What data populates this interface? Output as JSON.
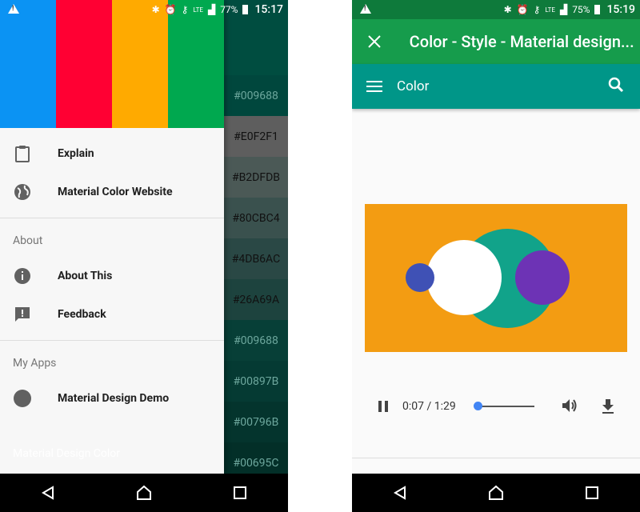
{
  "left": {
    "status": {
      "battery": "77%",
      "time": "15:17",
      "network": "LTE"
    },
    "drawer": {
      "title": "Material Design Color",
      "stripes": [
        "#0b93f3",
        "#ff0033",
        "#ffaa00",
        "#00a84f"
      ],
      "items": [
        {
          "label": "Explain",
          "icon": "clipboard-icon"
        },
        {
          "label": "Material Color Website",
          "icon": "globe-icon"
        }
      ],
      "section_about": "About",
      "about_items": [
        {
          "label": "About This",
          "icon": "info-icon"
        },
        {
          "label": "Feedback",
          "icon": "feedback-icon"
        }
      ],
      "section_apps": "My Apps",
      "apps_items": [
        {
          "label": "Material Design Demo",
          "icon": "circle-icon"
        }
      ]
    },
    "color_list": [
      {
        "hex": "#009688",
        "bg": "#00473d"
      },
      {
        "hex": "#E0F2F1",
        "bg": "#5e5e5e"
      },
      {
        "hex": "#B2DFDB",
        "bg": "#4b5956"
      },
      {
        "hex": "#80CBC4",
        "bg": "#3a514e"
      },
      {
        "hex": "#4DB6AC",
        "bg": "#2a4845"
      },
      {
        "hex": "#26A69A",
        "bg": "#1d433e"
      },
      {
        "hex": "#009688",
        "bg": "#073f37"
      },
      {
        "hex": "#00897B",
        "bg": "#053a33"
      },
      {
        "hex": "#00796B",
        "bg": "#04342d"
      },
      {
        "hex": "#00695C",
        "bg": "#032f28"
      }
    ]
  },
  "right": {
    "status": {
      "battery": "75%",
      "time": "15:19",
      "network": "LTE"
    },
    "appbar_title": "Color - Style - Material design...",
    "toolbar_title": "Color",
    "player": {
      "time": "0:07 / 1:29",
      "progress": 0.08
    }
  },
  "colors": {
    "statusbar_left": "#1565c0",
    "statusbar_right": "#0e7a3b",
    "teal": "#009688",
    "green": "#169c4c"
  }
}
